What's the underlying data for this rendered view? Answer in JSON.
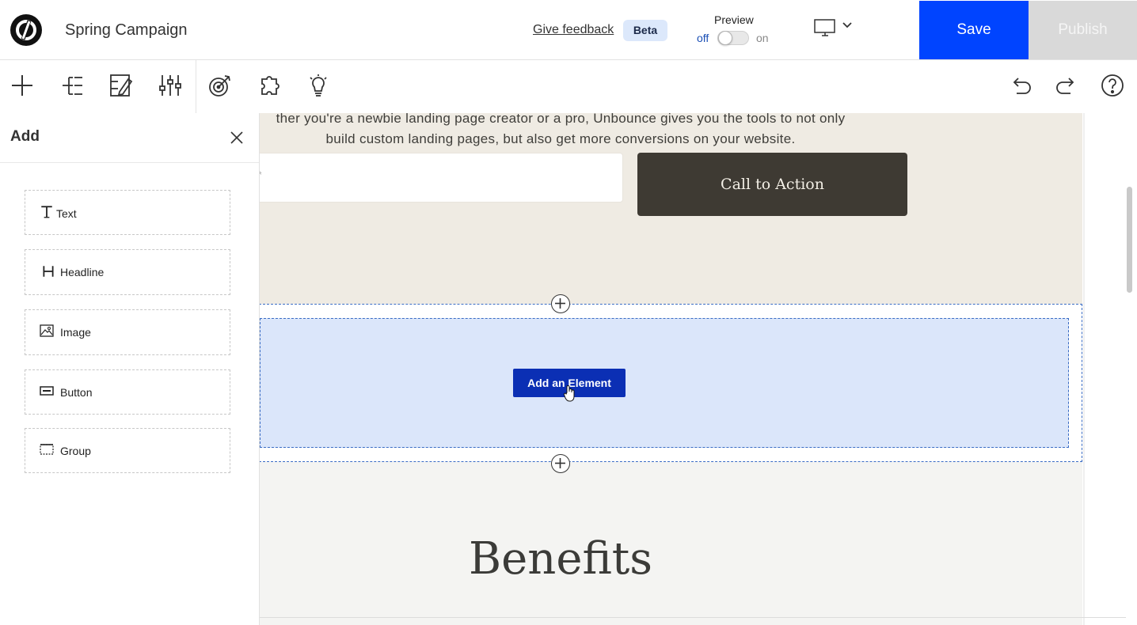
{
  "header": {
    "app_title": "Spring Campaign",
    "feedback_link": "Give feedback",
    "beta_badge": "Beta",
    "preview_label": "Preview",
    "preview_off": "off",
    "preview_on": "on",
    "preview_enabled": false,
    "device_icon": "desktop-monitor-icon",
    "save_label": "Save",
    "publish_label": "Publish",
    "accent_color": "#0044ff"
  },
  "toolbar": {
    "icons": [
      "add-icon",
      "page-tree-icon",
      "page-properties-icon",
      "settings-sliders-icon",
      "goals-target-icon",
      "integrations-puzzle-icon",
      "smart-traffic-bulb-icon"
    ],
    "right_icons": [
      "undo-icon",
      "redo-icon",
      "help-icon"
    ]
  },
  "panel": {
    "title": "Add",
    "items": [
      {
        "label": "Text",
        "icon": "text-icon"
      },
      {
        "label": "Headline",
        "icon": "headline-icon"
      },
      {
        "label": "Image",
        "icon": "image-icon"
      },
      {
        "label": "Button",
        "icon": "button-icon"
      },
      {
        "label": "Group",
        "icon": "group-icon"
      }
    ]
  },
  "canvas": {
    "hero_text_line1": "ther you're a newbie landing page creator or a pro, Unbounce gives you the tools to not only",
    "hero_text_line2": "build custom landing pages, but also get more conversions on your website.",
    "input_placeholder": "*",
    "cta_label": "Call to Action",
    "add_element_label": "Add an Element",
    "benefits_title": "Benefits"
  }
}
